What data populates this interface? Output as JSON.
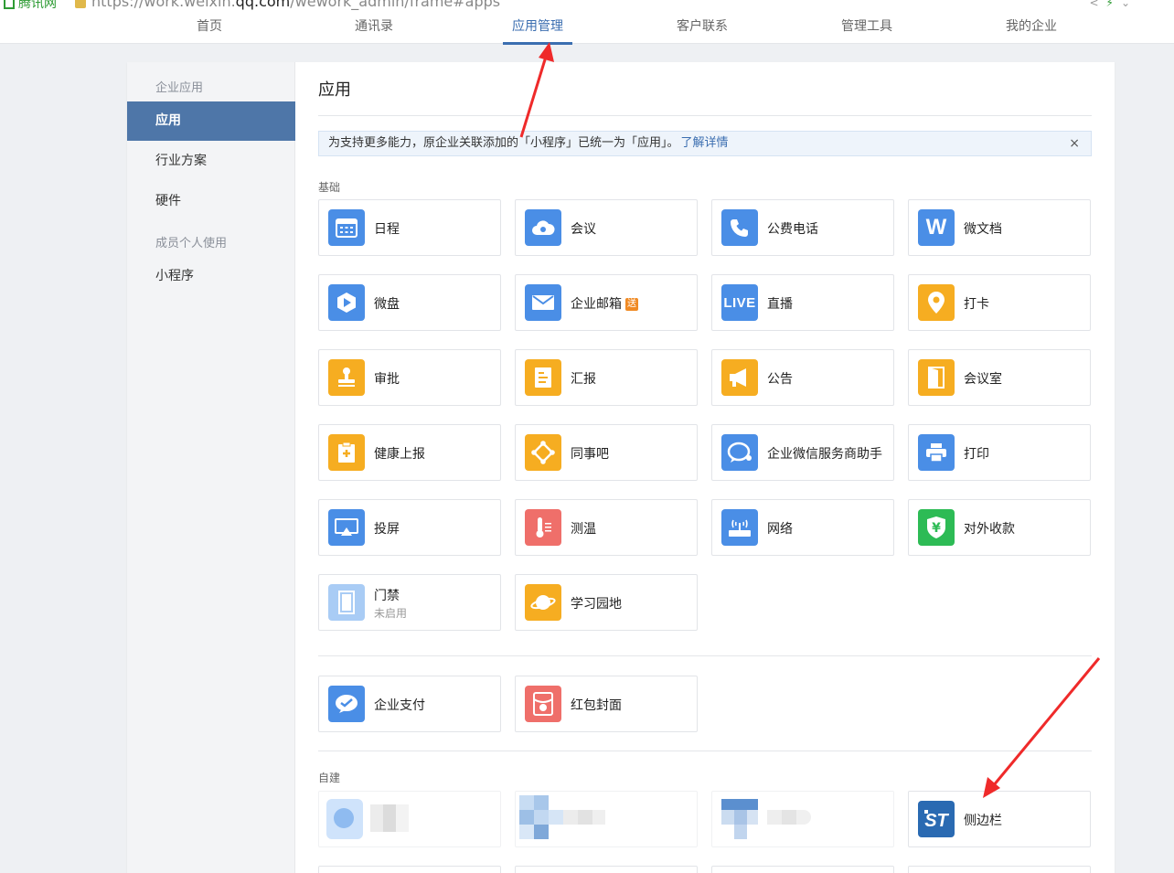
{
  "browser": {
    "site": "腾讯网",
    "url_pre": "https://work.weixin.",
    "url_dom": "qq.com",
    "url_post": "/wework_admin/frame#apps"
  },
  "topnav": {
    "tabs": [
      {
        "label": "首页"
      },
      {
        "label": "通讯录"
      },
      {
        "label": "应用管理"
      },
      {
        "label": "客户联系"
      },
      {
        "label": "管理工具"
      },
      {
        "label": "我的企业"
      }
    ]
  },
  "sidebar": {
    "group1": "企业应用",
    "items1": [
      {
        "label": "应用"
      },
      {
        "label": "行业方案"
      },
      {
        "label": "硬件"
      }
    ],
    "group2": "成员个人使用",
    "items2": [
      {
        "label": "小程序"
      }
    ]
  },
  "main": {
    "title": "应用",
    "notice": {
      "text": "为支持更多能力，原企业关联添加的「小程序」已统一为「应用」。",
      "link": "了解详情",
      "close": "×"
    },
    "basic_label": "基础",
    "basic_apps": [
      {
        "name": "日程",
        "icon": "calendar-icon",
        "color": "#4a8ee6"
      },
      {
        "name": "会议",
        "icon": "cloud-meeting-icon",
        "color": "#4a8ee6"
      },
      {
        "name": "公费电话",
        "icon": "phone-icon",
        "color": "#4a8ee6"
      },
      {
        "name": "微文档",
        "icon": "doc-w-icon",
        "color": "#4a8ee6"
      },
      {
        "name": "微盘",
        "icon": "drive-icon",
        "color": "#4a8ee6"
      },
      {
        "name": "企业邮箱",
        "icon": "mail-icon",
        "color": "#4a8ee6",
        "badge": "送"
      },
      {
        "name": "直播",
        "icon": "live-icon",
        "color": "#4a8ee6"
      },
      {
        "name": "打卡",
        "icon": "location-pin-icon",
        "color": "#f6ad21"
      },
      {
        "name": "审批",
        "icon": "stamp-icon",
        "color": "#f6ad21"
      },
      {
        "name": "汇报",
        "icon": "report-icon",
        "color": "#f6ad21"
      },
      {
        "name": "公告",
        "icon": "megaphone-icon",
        "color": "#f6ad21"
      },
      {
        "name": "会议室",
        "icon": "door-icon",
        "color": "#f6ad21"
      },
      {
        "name": "健康上报",
        "icon": "health-clipboard-icon",
        "color": "#f6ad21"
      },
      {
        "name": "同事吧",
        "icon": "network-icon",
        "color": "#f6ad21"
      },
      {
        "name": "企业微信服务商助手",
        "icon": "chat-bubble-icon",
        "color": "#4a8ee6"
      },
      {
        "name": "打印",
        "icon": "printer-icon",
        "color": "#4a8ee6"
      },
      {
        "name": "投屏",
        "icon": "screen-cast-icon",
        "color": "#4a8ee6"
      },
      {
        "name": "测温",
        "icon": "thermometer-icon",
        "color": "#ef6f6a"
      },
      {
        "name": "网络",
        "icon": "router-icon",
        "color": "#4a8ee6"
      },
      {
        "name": "对外收款",
        "icon": "yuan-shield-icon",
        "color": "#2dbb55"
      },
      {
        "name": "门禁",
        "sub": "未启用",
        "icon": "gate-icon",
        "color": "#a9ccf5"
      },
      {
        "name": "学习园地",
        "icon": "planet-icon",
        "color": "#f6ad21"
      }
    ],
    "extra_apps": [
      {
        "name": "企业支付",
        "icon": "payment-icon",
        "color": "#4a8ee6"
      },
      {
        "name": "红包封面",
        "icon": "red-packet-icon",
        "color": "#ef6f6a"
      }
    ],
    "custom_label": "自建",
    "custom_app": {
      "name": "侧边栏",
      "icon": "sidebar-logo-icon",
      "color": "#2a6ab2"
    }
  }
}
